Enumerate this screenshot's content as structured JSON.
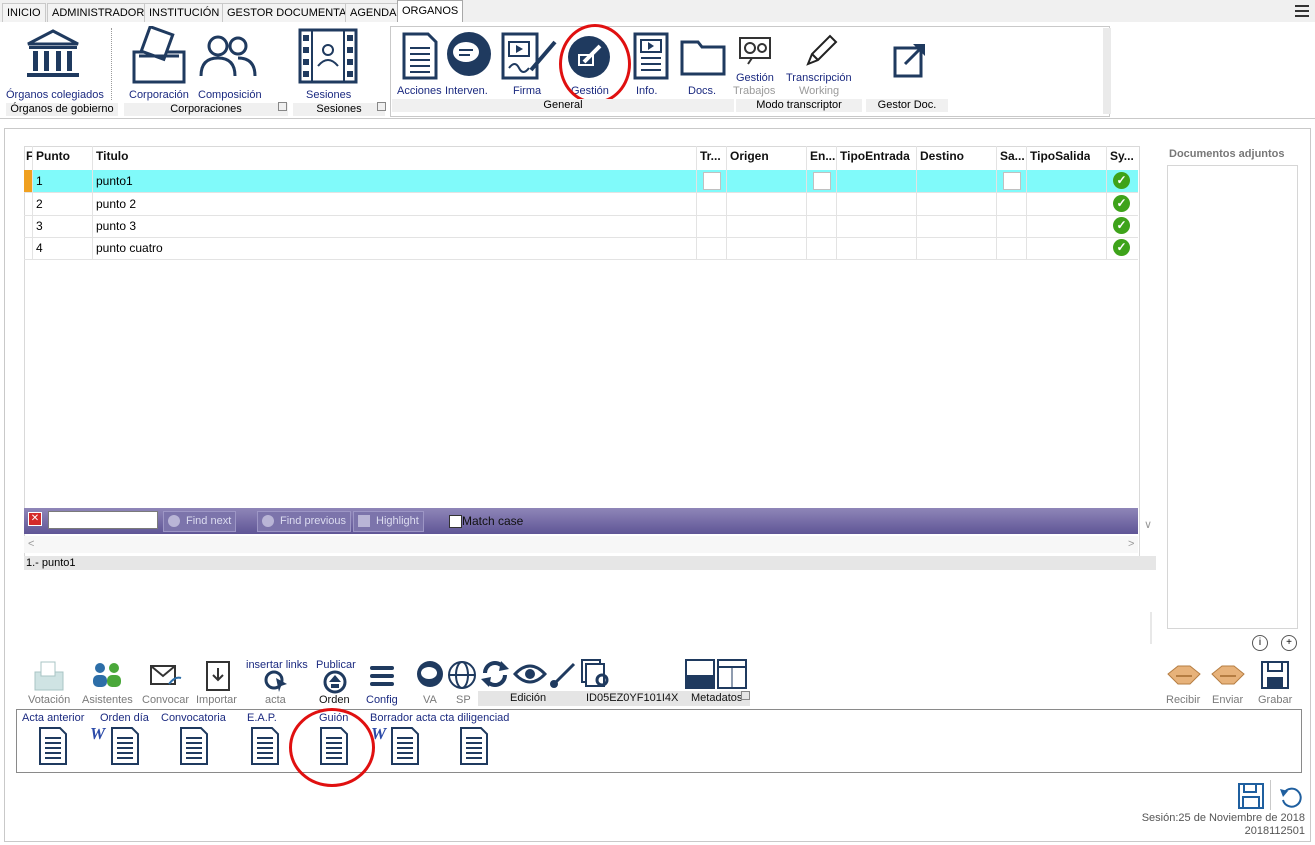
{
  "tabs": [
    "INICIO",
    "ADMINISTRADOR",
    "INSTITUCIÓN",
    "GESTOR DOCUMENTAL",
    "AGENDA",
    "ORGANOS"
  ],
  "active_tab": "ORGANOS",
  "ribbon": {
    "organos_colegiados": "Órganos colegiados",
    "group_organos": "Órganos de gobierno",
    "corporacion": "Corporación",
    "composicion": "Composición",
    "group_corporaciones": "Corporaciones",
    "sesiones": "Sesiones",
    "group_sesiones": "Sesiones",
    "acciones": "Acciones",
    "interven": "Interven.",
    "firma": "Firma",
    "gestion": "Gestión",
    "info": "Info.",
    "docs": "Docs.",
    "group_general": "General",
    "gestion_trabajos_1": "Gestión",
    "gestion_trabajos_2": "Trabajos",
    "transcripcion_1": "Transcripción",
    "transcripcion_2": "Working",
    "group_modo": "Modo transcriptor",
    "group_gestor": "Gestor Doc."
  },
  "grid": {
    "headers": {
      "flag": "F",
      "punto": "Punto",
      "titulo": "Titulo",
      "tr": "Tr...",
      "origen": "Origen",
      "en": "En...",
      "tipoentrada": "TipoEntrada",
      "destino": "Destino",
      "sa": "Sa...",
      "tiposalida": "TipoSalida",
      "sy": "Sy..."
    },
    "rows": [
      {
        "punto": "1",
        "titulo": "punto1"
      },
      {
        "punto": "2",
        "titulo": "punto 2"
      },
      {
        "punto": "3",
        "titulo": "punto 3"
      },
      {
        "punto": "4",
        "titulo": "punto cuatro"
      }
    ]
  },
  "findbar": {
    "find_next": "Find next",
    "find_previous": "Find previous",
    "highlight": "Highlight",
    "match_case": "Match case"
  },
  "breadcrumb": "1.- punto1",
  "right_panel": {
    "title": "Documentos adjuntos"
  },
  "bottom_toolbar": {
    "votacion": "Votación",
    "asistentes": "Asistentes",
    "convocar": "Convocar",
    "importar": "Importar",
    "insertar_links": "insertar links",
    "acta": "acta",
    "publicar": "Publicar",
    "orden": "Orden",
    "config": "Config",
    "va": "VA",
    "sp": "SP",
    "edicion": "Edición",
    "id": "ID05EZ0YF101I4X",
    "metadatos": "Metadatos",
    "recibir": "Recibir",
    "enviar": "Enviar",
    "grabar": "Grabar"
  },
  "documents": {
    "acta_anterior": "Acta anterior",
    "orden_dia": "Orden día",
    "convocatoria": "Convocatoria",
    "eap": "E.A.P.",
    "guion": "Guión",
    "borrador": "Borrador acta cta diligenciad",
    "word_mark": "W"
  },
  "session": {
    "line1": "Sesión:25 de Noviembre de 2018",
    "line2": "2018112501"
  },
  "colors": {
    "selected_row": "#80fafa",
    "accent_blue": "#1b2a80",
    "highlight_circle": "#e01010",
    "ok_green": "#3ea31a"
  }
}
